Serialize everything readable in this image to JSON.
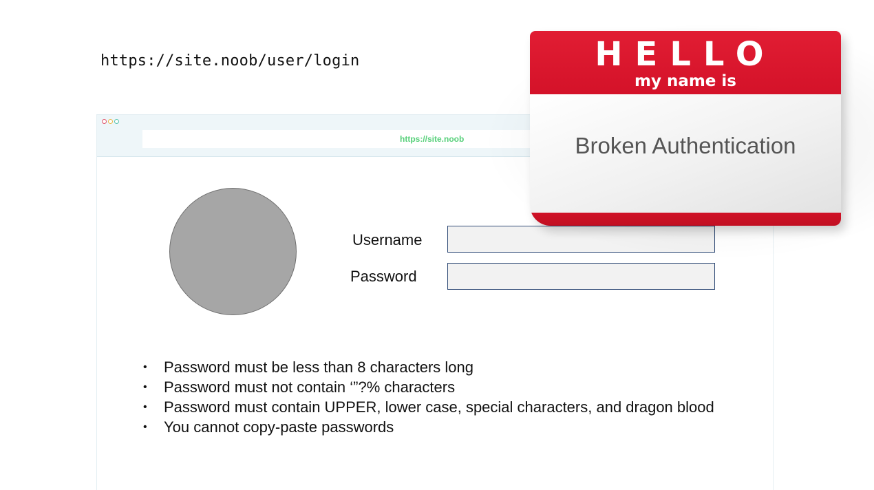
{
  "header": {
    "url": "https://site.noob/user/login"
  },
  "browser": {
    "address": "https://site.noob"
  },
  "form": {
    "username_label": "Username",
    "password_label": "Password",
    "username_value": "",
    "password_value": ""
  },
  "rules": [
    "Password must be less than 8 characters long",
    "Password must not contain ‘”?% characters",
    "Password must contain UPPER, lower case, special characters, and dragon blood",
    "You cannot copy-paste passwords"
  ],
  "bullet_glyph": "•",
  "name_tag": {
    "hello": "HELLO",
    "subtitle": "my name is",
    "name": "Broken Authentication"
  },
  "colors": {
    "tag_red": "#d41229",
    "address_green": "#57d07a",
    "field_border": "#2f4a76",
    "avatar_gray": "#a6a6a6"
  }
}
